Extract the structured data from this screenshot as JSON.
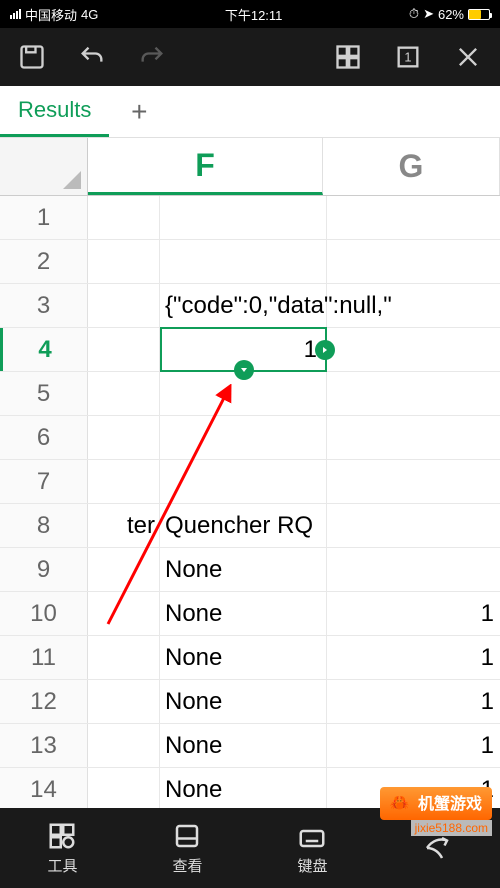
{
  "status": {
    "carrier": "中国移动",
    "network": "4G",
    "time": "下午12:11",
    "battery_pct": "62%"
  },
  "tabs": {
    "active": "Results"
  },
  "columns": {
    "f": "F",
    "g": "G"
  },
  "rows": [
    {
      "n": "1",
      "e": "",
      "f": "",
      "g": ""
    },
    {
      "n": "2",
      "e": "",
      "f": "",
      "g": ""
    },
    {
      "n": "3",
      "e": "",
      "f": "{\"code\":0,\"data\":null,\"",
      "g": ""
    },
    {
      "n": "4",
      "e": "",
      "f": "1",
      "g": ""
    },
    {
      "n": "5",
      "e": "",
      "f": "",
      "g": ""
    },
    {
      "n": "6",
      "e": "",
      "f": "",
      "g": ""
    },
    {
      "n": "7",
      "e": "",
      "f": "",
      "g": ""
    },
    {
      "n": "8",
      "e": "ter",
      "f": "Quencher RQ",
      "g": ""
    },
    {
      "n": "9",
      "e": "",
      "f": "None",
      "g": ""
    },
    {
      "n": "10",
      "e": "",
      "f": "None",
      "g": "1"
    },
    {
      "n": "11",
      "e": "",
      "f": "None",
      "g": "1"
    },
    {
      "n": "12",
      "e": "",
      "f": "None",
      "g": "1"
    },
    {
      "n": "13",
      "e": "",
      "f": "None",
      "g": "1"
    },
    {
      "n": "14",
      "e": "",
      "f": "None",
      "g": "1"
    }
  ],
  "active_row": "4",
  "nav": {
    "tools": "工具",
    "view": "查看",
    "keyboard": "键盘"
  },
  "watermark": {
    "brand": "机蟹游戏",
    "url": "jixie5188.com"
  },
  "colors": {
    "accent": "#0f9d58",
    "brand": "#ff6600"
  }
}
